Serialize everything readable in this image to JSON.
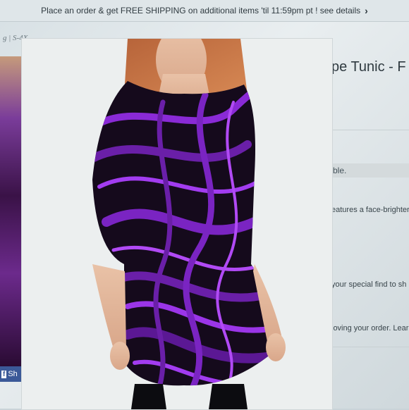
{
  "promo": {
    "text": "Place an order & get FREE SHIPPING on additional items 'til 11:59pm pt ! see details",
    "chevron": "›"
  },
  "breadcrumb": {
    "text": "g | S-4X"
  },
  "product": {
    "title_fragment": "pe Tunic - F",
    "availability_fragment": "ble.",
    "desc_line1": "eatures a face-brighter",
    "desc_line2": "your special find to sh",
    "desc_line3": "loving your order. Lear"
  },
  "share": {
    "fb_icon": "f",
    "label": "Sh"
  },
  "colors": {
    "accent": "#6a1fa8",
    "facebook": "#3b5998"
  },
  "icons": {
    "chevron": "chevron-right-icon",
    "facebook": "facebook-icon"
  }
}
